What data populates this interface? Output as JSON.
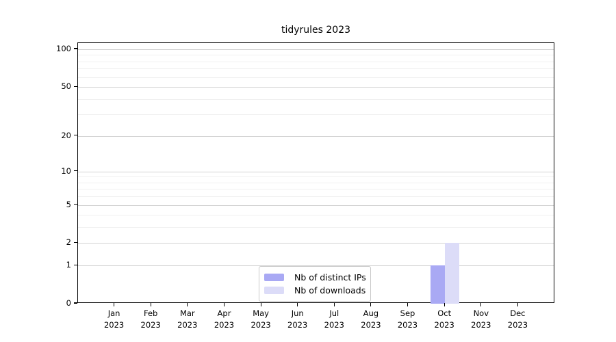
{
  "chart_data": {
    "type": "bar",
    "title": "tidyrules 2023",
    "categories": [
      "Jan",
      "Feb",
      "Mar",
      "Apr",
      "May",
      "Jun",
      "Jul",
      "Aug",
      "Sep",
      "Oct",
      "Nov",
      "Dec"
    ],
    "year": "2023",
    "series": [
      {
        "name": "Nb of distinct IPs",
        "color": "#a9a9f4",
        "values": [
          0,
          0,
          0,
          0,
          0,
          0,
          0,
          0,
          0,
          1,
          0,
          0
        ]
      },
      {
        "name": "Nb of downloads",
        "color": "#dcdcf8",
        "values": [
          0,
          0,
          0,
          0,
          0,
          0,
          0,
          0,
          0,
          2,
          0,
          0
        ]
      }
    ],
    "yscale": "log1p",
    "ylim": [
      0,
      100
    ],
    "yticks": [
      0,
      1,
      2,
      5,
      10,
      20,
      50,
      100
    ],
    "minor_gridlines": [
      3,
      4,
      6,
      7,
      8,
      9,
      30,
      40,
      60,
      70,
      80,
      90
    ],
    "grid": "horizontal",
    "legend_position": "bottom-center",
    "colors": {
      "major_grid": "#d2d2d2",
      "minor_grid": "#f0f0f0",
      "spine": "#000000",
      "background": "#ffffff"
    }
  }
}
